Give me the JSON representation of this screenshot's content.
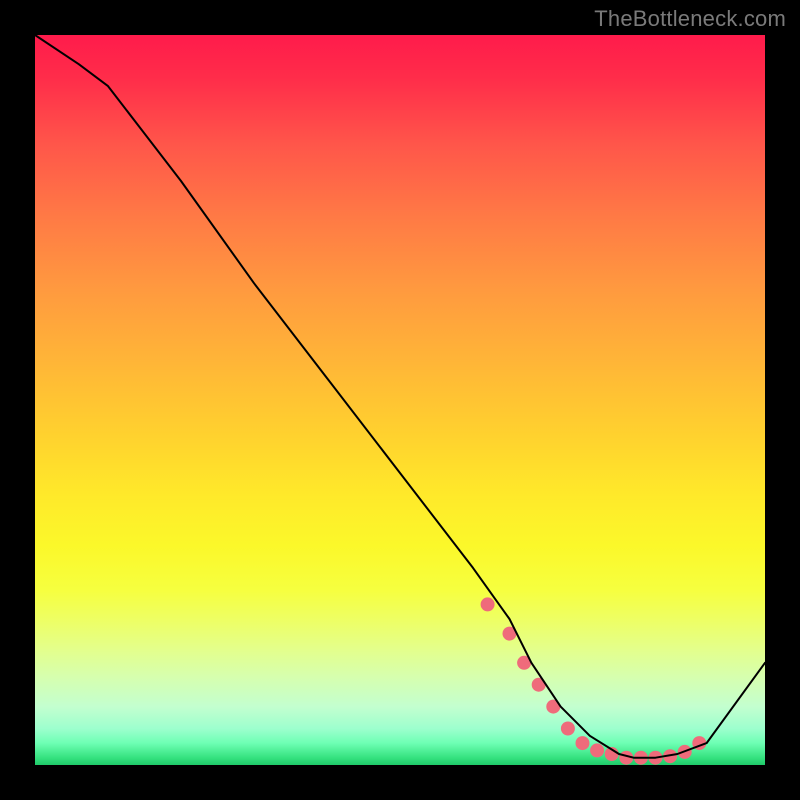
{
  "watermark": "TheBottleneck.com",
  "chart_data": {
    "type": "line",
    "title": "",
    "xlabel": "",
    "ylabel": "",
    "xlim": [
      0,
      100
    ],
    "ylim": [
      0,
      100
    ],
    "x": [
      0,
      6,
      10,
      20,
      30,
      40,
      50,
      60,
      65,
      68,
      72,
      76,
      80,
      82,
      85,
      88,
      92,
      100
    ],
    "values": [
      100,
      96,
      93,
      80,
      66,
      53,
      40,
      27,
      20,
      14,
      8,
      4,
      1.5,
      1,
      1,
      1.5,
      3,
      14
    ],
    "markers": {
      "x": [
        62,
        65,
        67,
        69,
        71,
        73,
        75,
        77,
        79,
        81,
        83,
        85,
        87,
        89,
        91
      ],
      "values": [
        22,
        18,
        14,
        11,
        8,
        5,
        3,
        2,
        1.5,
        1,
        1,
        1,
        1.2,
        1.8,
        3
      ],
      "color": "#ef6b7b",
      "radius": 7
    },
    "line_color": "#000000",
    "line_width": 2
  }
}
